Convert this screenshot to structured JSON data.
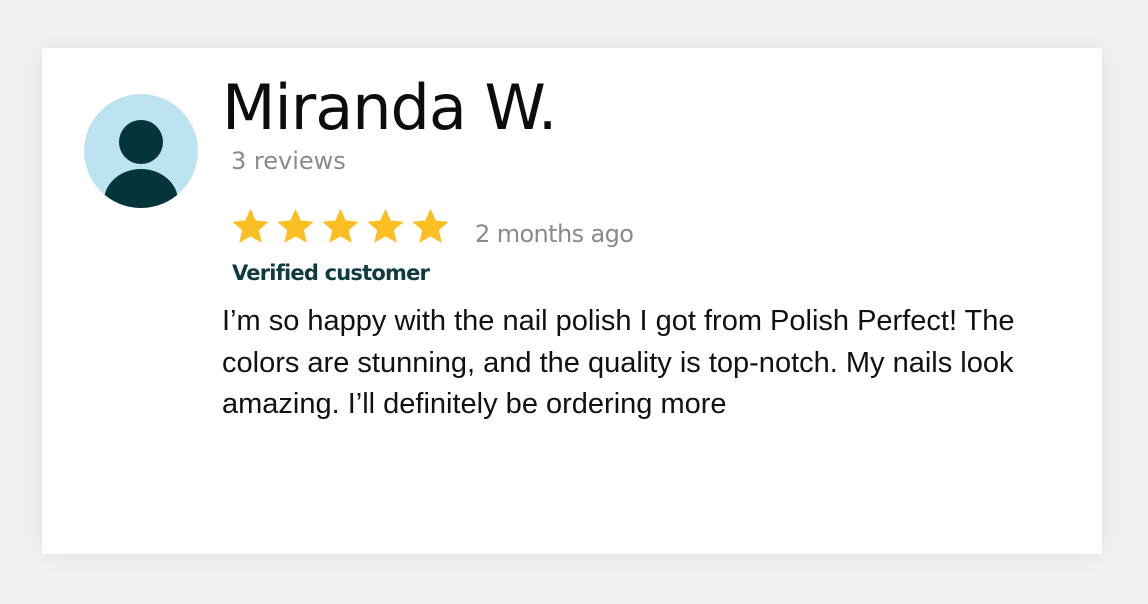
{
  "review": {
    "reviewer_name": "Miranda W.",
    "review_count": "3 reviews",
    "rating": 5,
    "rating_max": 5,
    "date": "2 months ago",
    "badge": "Verified customer",
    "text": "I’m so happy with the nail polish I got from Polish Perfect! The colors are stunning, and the quality is top-notch. My nails look amazing. I’ll definitely be ordering more",
    "avatar_icon": "user-icon"
  },
  "colors": {
    "background": "#f2f1ef",
    "card": "#ffffff",
    "avatar_bg": "#bde2f0",
    "avatar_figure": "#05343b",
    "star": "#fbbf24",
    "badge_text": "#0f3a3e",
    "muted_text": "#8a8a8a"
  }
}
